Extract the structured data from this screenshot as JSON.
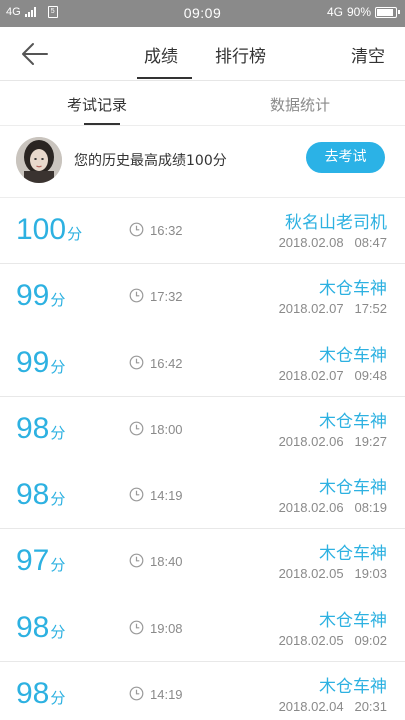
{
  "status_bar": {
    "network": "4G",
    "sim": "5",
    "time": "09:09",
    "right_network": "4G",
    "battery": "90%"
  },
  "header": {
    "tabs": [
      {
        "label": "成绩",
        "active": true
      },
      {
        "label": "排行榜",
        "active": false
      }
    ],
    "clear_label": "清空"
  },
  "subtabs": [
    {
      "label": "考试记录",
      "active": true
    },
    {
      "label": "数据统计",
      "active": false
    }
  ],
  "banner": {
    "text": "您的历史最高成绩100分",
    "button_label": "去考试"
  },
  "records": [
    {
      "score": "100",
      "unit": "分",
      "duration": "16:32",
      "name": "秋名山老司机",
      "date": "2018.02.08   08:47"
    },
    {
      "score": "99",
      "unit": "分",
      "duration": "17:32",
      "name": "木仓车神",
      "date": "2018.02.07   17:52"
    },
    {
      "score": "99",
      "unit": "分",
      "duration": "16:42",
      "name": "木仓车神",
      "date": "2018.02.07   09:48"
    },
    {
      "score": "98",
      "unit": "分",
      "duration": "18:00",
      "name": "木仓车神",
      "date": "2018.02.06   19:27"
    },
    {
      "score": "98",
      "unit": "分",
      "duration": "14:19",
      "name": "木仓车神",
      "date": "2018.02.06   08:19"
    },
    {
      "score": "97",
      "unit": "分",
      "duration": "18:40",
      "name": "木仓车神",
      "date": "2018.02.05   19:03"
    },
    {
      "score": "98",
      "unit": "分",
      "duration": "19:08",
      "name": "木仓车神",
      "date": "2018.02.05   09:02"
    },
    {
      "score": "98",
      "unit": "分",
      "duration": "14:19",
      "name": "木仓车神",
      "date": "2018.02.04   20:31"
    }
  ],
  "colors": {
    "accent": "#2db1e1",
    "button": "#2bb2e6",
    "status_bar": "#8a8a8a"
  }
}
